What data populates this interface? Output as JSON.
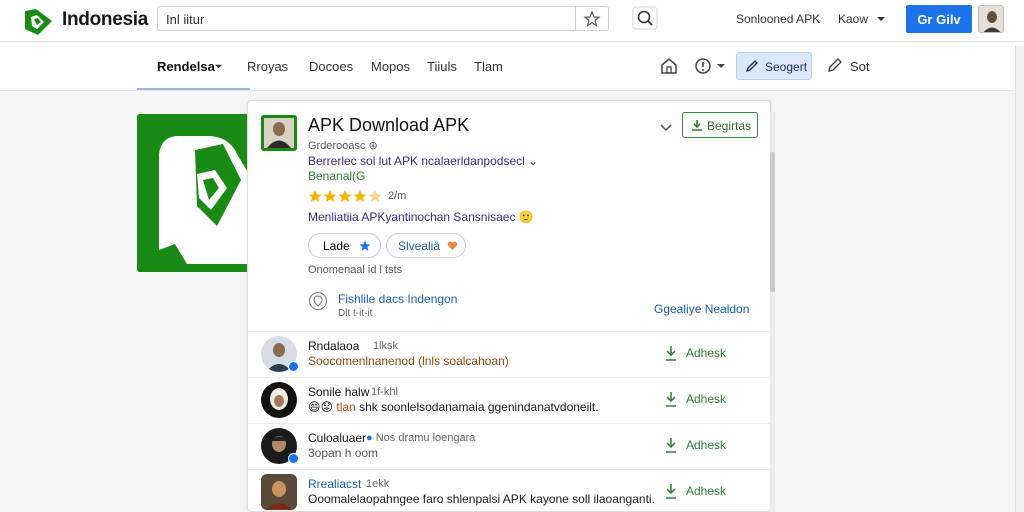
{
  "header": {
    "brand": "Indonesia",
    "search_value": "Inl iitur",
    "top_link": "Sonlooned APK",
    "account_label": "Kaow",
    "cta_label": "Gr Gilv"
  },
  "nav": {
    "items": [
      "Rendelsa",
      "Rroyas",
      "Docoes",
      "Mopos",
      "Tiiuls",
      "Tlam"
    ],
    "suggest_label": "Seogert",
    "sort_label": "Sot"
  },
  "app": {
    "title": "APK Download APK",
    "install_label": "Begirtas",
    "developer": "Grderooasc",
    "category": "Berrerlec sol lut APK ncalaerldanpodsecl",
    "price": "Benanal(G",
    "rating": 4.5,
    "rating_count": "2/m",
    "tagline": "Menliatiia APKyantinochan Sansnisaec",
    "pill_primary": "Lade",
    "pill_secondary": "Slvealiä",
    "meta": "Onomenaal id l tsts",
    "location_title": "Fishlile dacs Indengon",
    "location_sub": "Dlt t-it-it",
    "location_link": "Ggealiye Nealdon"
  },
  "reviews": [
    {
      "name": "Rndalaoa",
      "meta": "1lksk",
      "text": "Soocomenlnanenod (lnls soalcahoan)",
      "action": "Adhesk",
      "orange": true
    },
    {
      "name": "Sonile halw",
      "meta": "1f-khl",
      "text_highlight": "tlan",
      "text": "shk soonlelsodanamaia ggenindanatvdoneilt.",
      "action": "Adhesk",
      "orange": false
    },
    {
      "name": "Culoaluaer",
      "meta": "Nos dramu loengara",
      "text": "3opan h oom",
      "action": "Adhesk",
      "orange": false
    },
    {
      "name": "Rrealiacst",
      "meta": "1ekk",
      "text": "Ooomalelaopahngee faro shlenpalsi APK kayone soll ilaoanganti.",
      "action": "Adhesk",
      "orange": false
    }
  ],
  "colors": {
    "brand_green": "#1a8a16",
    "accent_blue": "#1a73e8",
    "link_blue": "#1a5fa8",
    "action_green": "#2e7d32",
    "star_gold": "#f4b400"
  }
}
